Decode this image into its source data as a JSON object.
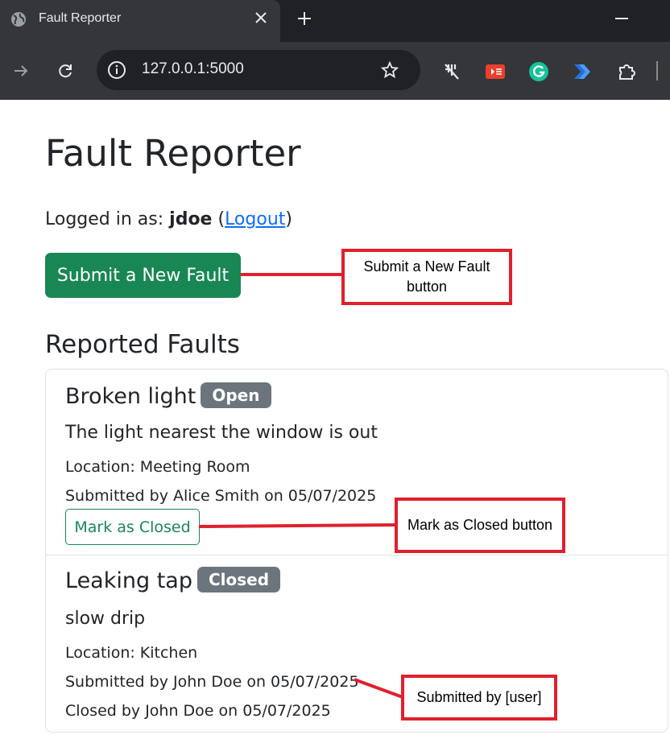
{
  "browser": {
    "tab_title": "Fault Reporter",
    "url": "127.0.0.1:5000"
  },
  "page": {
    "title": "Fault Reporter",
    "logged_in_prefix": "Logged in as: ",
    "username": "jdoe",
    "open_paren": " (",
    "logout_label": "Logout",
    "close_paren": ")",
    "submit_button_label": "Submit a New Fault",
    "section_title": "Reported Faults",
    "faults": [
      {
        "title": "Broken light",
        "status": "Open",
        "description": "The light nearest the window is out",
        "location": "Location: Meeting Room",
        "submitted": "Submitted by Alice Smith on 05/07/2025",
        "action_label": "Mark as Closed"
      },
      {
        "title": "Leaking tap",
        "status": "Closed",
        "description": "slow drip",
        "location": "Location: Kitchen",
        "submitted": "Submitted by John Doe on 05/07/2025",
        "closed": "Closed by John Doe on 05/07/2025"
      }
    ]
  },
  "annotations": {
    "submit_fault": "Submit a New Fault button",
    "mark_closed": "Mark as Closed button",
    "submitted_by": "Submitted by [user]",
    "color": "#e0202c"
  },
  "colors": {
    "success": "#198754",
    "badge": "#6c757d",
    "link": "#0d6efd",
    "chrome_dark": "#202124",
    "chrome_toolbar": "#35363a"
  }
}
